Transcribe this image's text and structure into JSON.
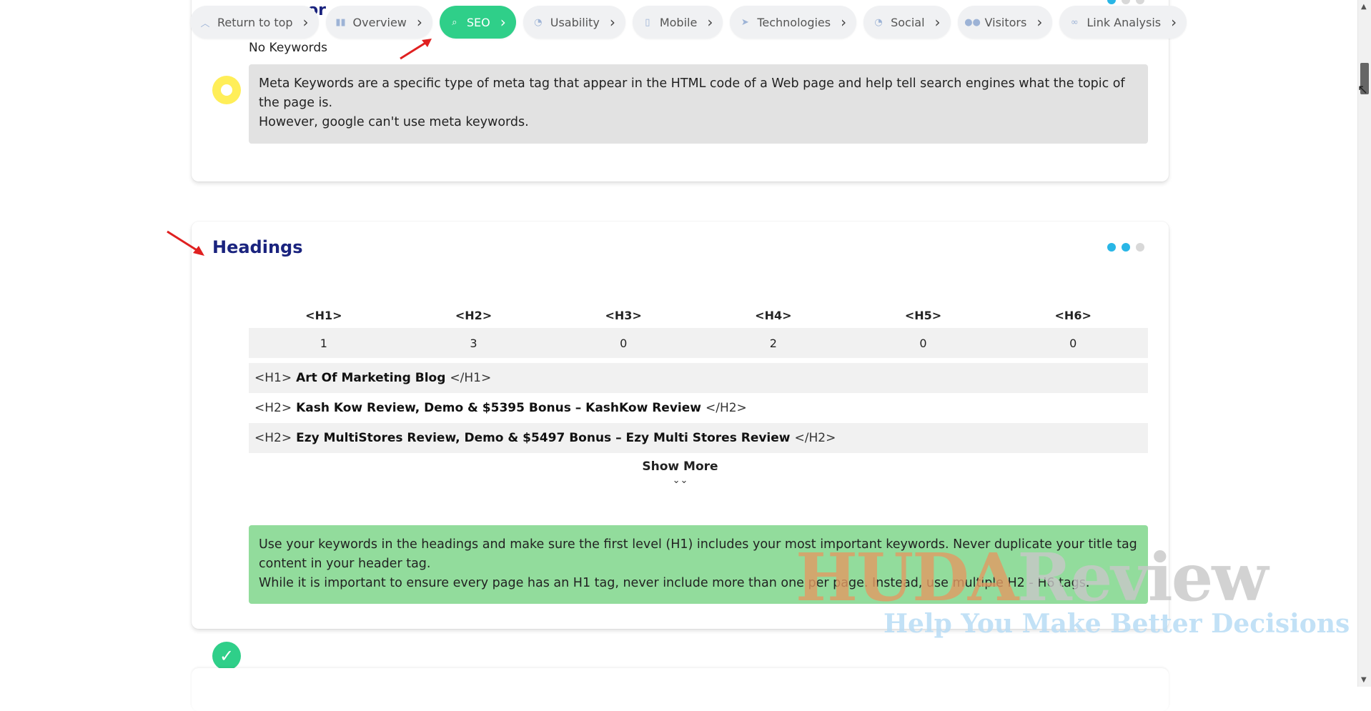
{
  "nav": {
    "items": [
      {
        "label": "Return to top",
        "icon": "chevron-up-icon"
      },
      {
        "label": "Overview",
        "icon": "bar-chart-icon"
      },
      {
        "label": "SEO",
        "icon": "search-icon",
        "active": true
      },
      {
        "label": "Usability",
        "icon": "thumbs-up-icon"
      },
      {
        "label": "Mobile",
        "icon": "mobile-icon"
      },
      {
        "label": "Technologies",
        "icon": "paper-plane-icon"
      },
      {
        "label": "Social",
        "icon": "thumbs-up-icon"
      },
      {
        "label": "Visitors",
        "icon": "users-icon"
      },
      {
        "label": "Link Analysis",
        "icon": "link-icon"
      }
    ]
  },
  "keywords_card": {
    "status": "No Keywords",
    "info_lines": [
      "Meta Keywords are a specific type of meta tag that appear in the HTML code of a Web page and help tell search engines what the topic of the page is.",
      "However, google can't use meta keywords."
    ]
  },
  "headings_card": {
    "title": "Headings",
    "table_headers": [
      "<H1>",
      "<H2>",
      "<H3>",
      "<H4>",
      "<H5>",
      "<H6>"
    ],
    "table_values": [
      "1",
      "3",
      "0",
      "2",
      "0",
      "0"
    ],
    "heading_list": [
      {
        "open": "<H1>",
        "text": "Art Of Marketing Blog",
        "close": "</H1>"
      },
      {
        "open": "<H2>",
        "text": "Kash Kow Review, Demo & $5395 Bonus – KashKow Review",
        "close": "</H2>"
      },
      {
        "open": "<H2>",
        "text": "Ezy MultiStores Review, Demo & $5497 Bonus – Ezy Multi Stores Review",
        "close": "</H2>"
      }
    ],
    "show_more": "Show More",
    "info_lines": [
      "Use your keywords in the headings and make sure the first level (H1) includes your most important keywords. Never duplicate your title tag content in your header tag.",
      "While it is important to ensure every page has an H1 tag, never include more than one per page. Instead, use multiple H2 - H6 tags."
    ]
  },
  "watermark": {
    "brand_part1": "HUDA",
    "brand_part2": "Review",
    "tagline": "Help You Make Better Decisions"
  },
  "colors": {
    "accent_green": "#2fcf89",
    "title_navy": "#1a237e",
    "dot_blue": "#29b6e6",
    "annotation_red": "#e02020"
  }
}
